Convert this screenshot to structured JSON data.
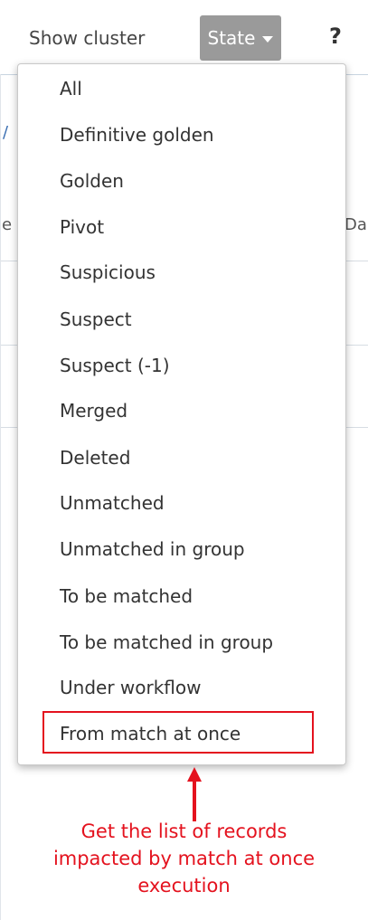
{
  "toolbar": {
    "show_cluster_label": "Show cluster",
    "state_button_label": "State",
    "help_label": "?"
  },
  "background": {
    "column_fragment_left": "e",
    "column_fragment_right": "Da",
    "left_edge_fragment": "/"
  },
  "dropdown": {
    "items": [
      {
        "label": "All"
      },
      {
        "label": "Definitive golden"
      },
      {
        "label": "Golden"
      },
      {
        "label": "Pivot"
      },
      {
        "label": "Suspicious"
      },
      {
        "label": "Suspect"
      },
      {
        "label": "Suspect (-1)"
      },
      {
        "label": "Merged"
      },
      {
        "label": "Deleted"
      },
      {
        "label": "Unmatched"
      },
      {
        "label": "Unmatched in group"
      },
      {
        "label": "To be matched"
      },
      {
        "label": "To be matched in group"
      },
      {
        "label": "Under workflow"
      },
      {
        "label": "From match at once"
      }
    ]
  },
  "annotation": {
    "line1": "Get the list of records",
    "line2": "impacted by match at once",
    "line3": "execution"
  },
  "colors": {
    "annotation_red": "#e4121e",
    "state_button_bg": "#9a9a9a",
    "menu_text": "#333333"
  },
  "icons": {
    "state_caret": "caret-down-icon",
    "annotation_arrow": "arrow-up-icon"
  }
}
